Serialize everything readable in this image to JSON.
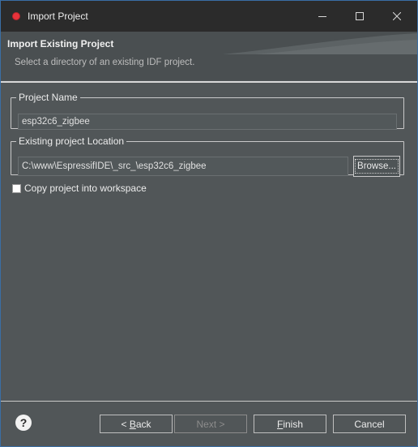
{
  "window": {
    "title": "Import Project"
  },
  "banner": {
    "title": "Import Existing Project",
    "subtitle": "Select a directory of an existing IDF project."
  },
  "project_name": {
    "legend": "Project Name",
    "value": "esp32c6_zigbee"
  },
  "location": {
    "legend": "Existing project Location",
    "value": "C:\\www\\EspressifIDE\\_src_\\esp32c6_zigbee",
    "browse_label": "Browse..."
  },
  "copy_checkbox": {
    "label": "Copy project into workspace",
    "checked": false
  },
  "footer": {
    "help_glyph": "?",
    "back_prefix": "< ",
    "back_mnemonic": "B",
    "back_rest": "ack",
    "next_label": "Next >",
    "finish_mnemonic": "F",
    "finish_rest": "inish",
    "cancel_label": "Cancel"
  },
  "colors": {
    "background": "#515658",
    "titlebar": "#2b2b2b",
    "app_icon": "#e8333b"
  }
}
